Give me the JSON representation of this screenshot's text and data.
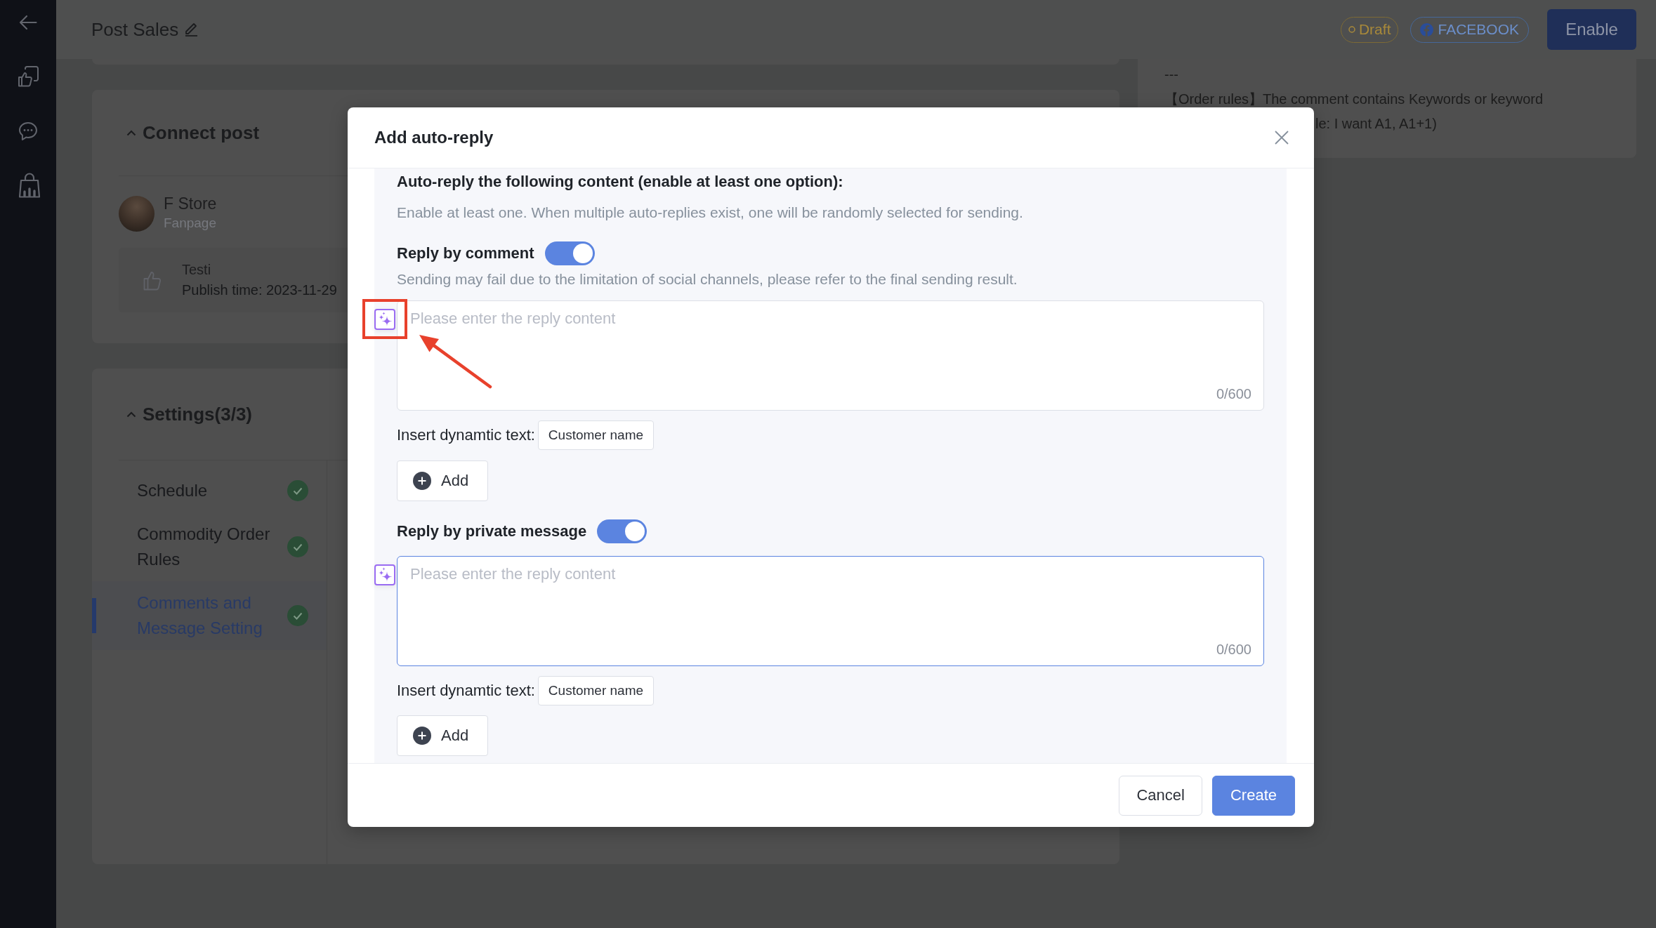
{
  "header": {
    "title": "Post Sales",
    "status_badge": "Draft",
    "channel_badge": "FACEBOOK",
    "primary_button": "Enable"
  },
  "connect_post": {
    "title": "Connect post",
    "expanded": true,
    "page": {
      "name": "F Store",
      "type": "Fanpage"
    },
    "post": {
      "title": "Testi",
      "publish_time": "Publish time: 2023-11-29"
    }
  },
  "settings": {
    "title": "Settings(3/3)",
    "expanded": true,
    "items": [
      {
        "label": "Schedule",
        "done": true,
        "selected": false
      },
      {
        "label": "Commodity Order Rules",
        "done": true,
        "selected": false
      },
      {
        "label": "Comments and Message Setting",
        "done": true,
        "selected": true
      }
    ]
  },
  "rules_note": {
    "lines": [
      "---",
      "【Order rules】The comment contains Keywords or keyword"
    ],
    "partial_line": "le: I want A1, A1+1)"
  },
  "dialog": {
    "title": "Add auto-reply",
    "heading": "Auto-reply the following content (enable at least one option):",
    "hint": "Enable at least one. When multiple auto-replies exist, one will be randomly selected for sending.",
    "sections": [
      {
        "label": "Reply by comment",
        "on": true,
        "note": "Sending may fail due to the limitation of social channels, please refer to the final sending result.",
        "placeholder": "Please enter the reply content",
        "counter": "0/600",
        "focused": false,
        "annotated": true,
        "dynamic_label": "Insert dynamtic text:",
        "chips": [
          "Customer name"
        ],
        "add_button": "Add"
      },
      {
        "label": "Reply by private message",
        "on": true,
        "placeholder": "Please enter the reply content",
        "counter": "0/600",
        "focused": true,
        "annotated": false,
        "dynamic_label": "Insert dynamtic text:",
        "chips": [
          "Customer name"
        ],
        "add_button": "Add"
      }
    ],
    "buttons": [
      {
        "label": "Cancel",
        "kind": "secondary"
      },
      {
        "label": "Create",
        "kind": "primary"
      }
    ]
  }
}
